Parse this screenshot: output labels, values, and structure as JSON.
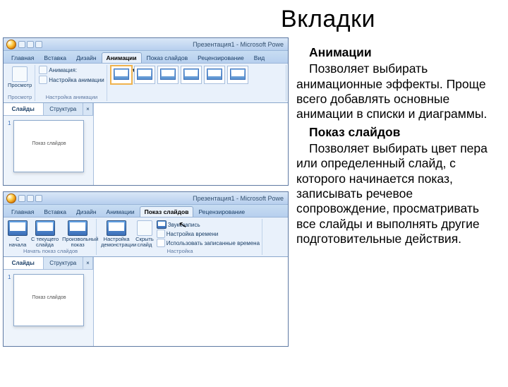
{
  "page": {
    "title": "Вкладки"
  },
  "text": {
    "heading1": "Анимации",
    "para1": "Позволяет выбирать анимационные эффекты. Проще всего добавлять основные анимации в списки и диаграммы.",
    "heading2": "Показ слайдов",
    "para2": "Позволяет выбирать цвет пера или определенный слайд, с которого начинается показ, записывать речевое сопровождение, просматривать все слайды и выполнять другие подготовительные действия."
  },
  "shot_common": {
    "window_title": "Презентация1 - Microsoft Powe",
    "nav_slides": "Слайды",
    "nav_outline": "Структура",
    "thumb_caption": "Показ слайдов"
  },
  "shot1": {
    "tabs": [
      "Главная",
      "Вставка",
      "Дизайн",
      "Анимации",
      "Показ слайдов",
      "Рецензирование",
      "Вид"
    ],
    "active_tab_index": 3,
    "group_preview": "Просмотр",
    "btn_preview": "Просмотр",
    "btn_anim": "Анимация:",
    "btn_custom": "Настройка анимации",
    "group_anim": "Настройка анимации"
  },
  "shot2": {
    "tabs": [
      "Главная",
      "Вставка",
      "Дизайн",
      "Анимации",
      "Показ слайдов",
      "Рецензирование"
    ],
    "active_tab_index": 4,
    "btn_from_start_1": "С",
    "btn_from_start_2": "начала",
    "btn_from_current_1": "С текущего",
    "btn_from_current_2": "слайда",
    "btn_custom_1": "Произвольный",
    "btn_custom_2": "показ",
    "group_start": "Начать показ слайдов",
    "btn_setup_1": "Настройка",
    "btn_setup_2": "демонстрации",
    "btn_hide_1": "Скрыть",
    "btn_hide_2": "слайд",
    "opt_record": "Звукозапись",
    "opt_rehearse": "Настройка времени",
    "opt_use_times": "Использовать записанные времена",
    "group_setup": "Настройка"
  }
}
